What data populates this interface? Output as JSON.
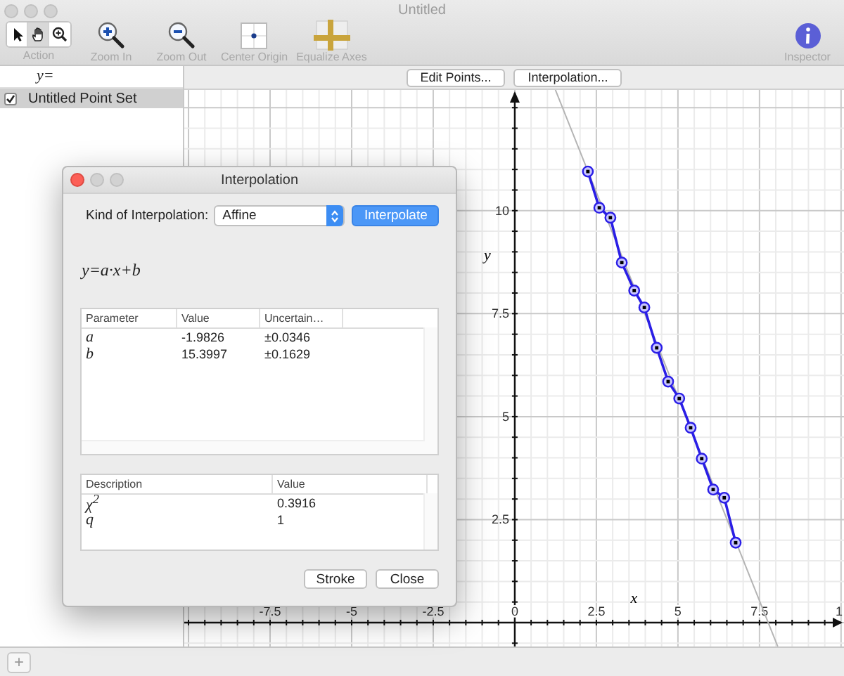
{
  "window": {
    "title": "Untitled"
  },
  "toolbar": {
    "items": [
      {
        "kind": "action",
        "label": "Action",
        "tools": [
          {
            "kind": "pointer",
            "selected": false
          },
          {
            "kind": "hand",
            "selected": true
          },
          {
            "kind": "zoom",
            "selected": false
          }
        ]
      },
      {
        "kind": "zoom_in",
        "label": "Zoom In"
      },
      {
        "kind": "zoom_out",
        "label": "Zoom Out"
      },
      {
        "kind": "center_origin",
        "label": "Center Origin"
      },
      {
        "kind": "equalize_axes",
        "label": "Equalize Axes"
      }
    ],
    "inspector": {
      "kind": "inspector",
      "label": "Inspector"
    }
  },
  "sidebar": {
    "header": "y=",
    "items": [
      {
        "label": "Untitled Point Set",
        "checked": true,
        "selected": true
      }
    ]
  },
  "graph": {
    "buttons": [
      "Edit Points...",
      "Interpolation..."
    ],
    "edge_text": "1",
    "chart_data": {
      "type": "line",
      "xlabel": "x",
      "ylabel": "y",
      "xlim": [
        -10.13,
        10.09
      ],
      "ylim": [
        -0.58,
        12.93
      ],
      "xticks": [
        -7.5,
        -5,
        -2.5,
        0,
        2.5,
        5,
        7.5
      ],
      "yticks": [
        2.5,
        5,
        7.5,
        10
      ],
      "grid": true,
      "x": [
        2.24,
        2.59,
        2.93,
        3.28,
        3.66,
        3.97,
        4.35,
        4.7,
        5.04,
        5.39,
        5.73,
        6.08,
        6.42,
        6.77
      ],
      "series": [
        {
          "color": "#2a1ee6",
          "marker": "circle",
          "values": [
            10.95,
            10.07,
            9.83,
            8.74,
            8.06,
            7.65,
            6.67,
            5.85,
            5.44,
            4.73,
            3.98,
            3.23,
            3.03,
            1.94
          ]
        }
      ]
    }
  },
  "dialog": {
    "title": "Interpolation",
    "kind_label": "Kind of Interpolation:",
    "kind_value": "Affine",
    "interpolate_button": {
      "label": "Interpolate",
      "default": true
    },
    "formula": "y=a·x+b",
    "parameters": {
      "columns": [
        "Parameter",
        "Value",
        "Uncertain…"
      ],
      "rows": [
        {
          "name": "a",
          "value": "-1.9826",
          "uncertainty": "±0.0346"
        },
        {
          "name": "b",
          "value": "15.3997",
          "uncertainty": "±0.1629"
        }
      ]
    },
    "results": {
      "columns": [
        "Description",
        "Value"
      ],
      "rows": [
        {
          "name": "χ$^{2}$",
          "value": "0.3916"
        },
        {
          "name": "q",
          "value": "1"
        }
      ]
    },
    "buttons": [
      "Stroke",
      "Close"
    ]
  },
  "bottom_bar": {
    "add_button": "+"
  }
}
